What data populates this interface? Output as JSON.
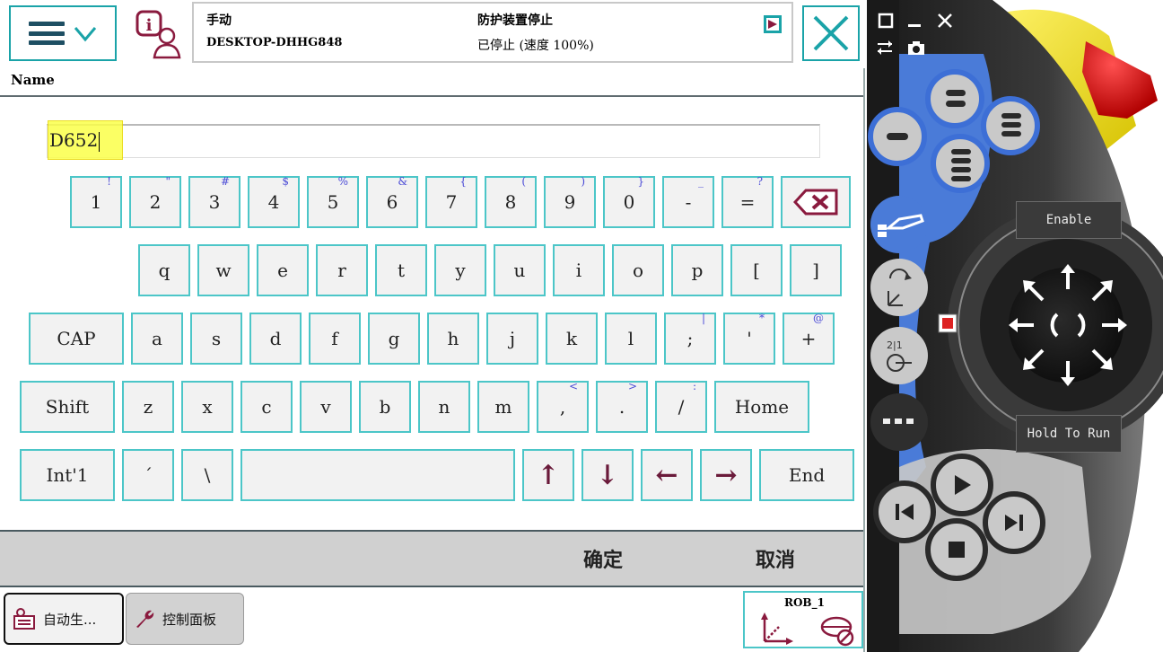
{
  "header": {
    "mode": "手动",
    "host": "DESKTOP-DHHG848",
    "guard_status": "防护装置停止",
    "run_status": "已停止 (速度 100%)"
  },
  "dialog": {
    "field_label": "Name",
    "input_value": "D652"
  },
  "keyboard": {
    "row1": [
      {
        "main": "1",
        "shift": "!"
      },
      {
        "main": "2",
        "shift": "\""
      },
      {
        "main": "3",
        "shift": "#"
      },
      {
        "main": "4",
        "shift": "$"
      },
      {
        "main": "5",
        "shift": "%"
      },
      {
        "main": "6",
        "shift": "&"
      },
      {
        "main": "7",
        "shift": "{"
      },
      {
        "main": "8",
        "shift": "("
      },
      {
        "main": "9",
        "shift": ")"
      },
      {
        "main": "0",
        "shift": "}"
      },
      {
        "main": "-",
        "shift": "_"
      },
      {
        "main": "=",
        "shift": "?"
      }
    ],
    "row2": [
      "q",
      "w",
      "e",
      "r",
      "t",
      "y",
      "u",
      "i",
      "o",
      "p",
      "[",
      "]"
    ],
    "row3_keys": [
      {
        "main": "a",
        "shift": ""
      },
      {
        "main": "s",
        "shift": ""
      },
      {
        "main": "d",
        "shift": ""
      },
      {
        "main": "f",
        "shift": ""
      },
      {
        "main": "g",
        "shift": ""
      },
      {
        "main": "h",
        "shift": ""
      },
      {
        "main": "j",
        "shift": ""
      },
      {
        "main": "k",
        "shift": ""
      },
      {
        "main": "l",
        "shift": ""
      },
      {
        "main": ";",
        "shift": "|"
      },
      {
        "main": "'",
        "shift": "*"
      },
      {
        "main": "+",
        "shift": "@"
      }
    ],
    "row4_keys": [
      {
        "main": "z",
        "shift": ""
      },
      {
        "main": "x",
        "shift": ""
      },
      {
        "main": "c",
        "shift": ""
      },
      {
        "main": "v",
        "shift": ""
      },
      {
        "main": "b",
        "shift": ""
      },
      {
        "main": "n",
        "shift": ""
      },
      {
        "main": "m",
        "shift": ""
      },
      {
        "main": ",",
        "shift": "<"
      },
      {
        "main": ".",
        "shift": ">"
      },
      {
        "main": "/",
        "shift": ":"
      }
    ],
    "cap": "CAP",
    "shift": "Shift",
    "home": "Home",
    "intl": "Int'1",
    "acute": "´",
    "backslash": "\\",
    "end": "End",
    "arrow_up": "↑",
    "arrow_down": "↓",
    "arrow_left": "←",
    "arrow_right": "→"
  },
  "actions": {
    "ok": "确定",
    "cancel": "取消"
  },
  "taskbar": {
    "task1": "自动生...",
    "task2": "控制面板",
    "robot": "ROB_1"
  },
  "pendant": {
    "enable": "Enable",
    "hold_to_run": "Hold To Run"
  },
  "colors": {
    "key_border": "#4cc6c8",
    "accent_teal": "#1aa3a8",
    "input_highlight": "#fbff4a",
    "pendant_blue": "#4a7bd8",
    "estop_red": "#e21b1b",
    "estop_yellow": "#f5e600"
  }
}
